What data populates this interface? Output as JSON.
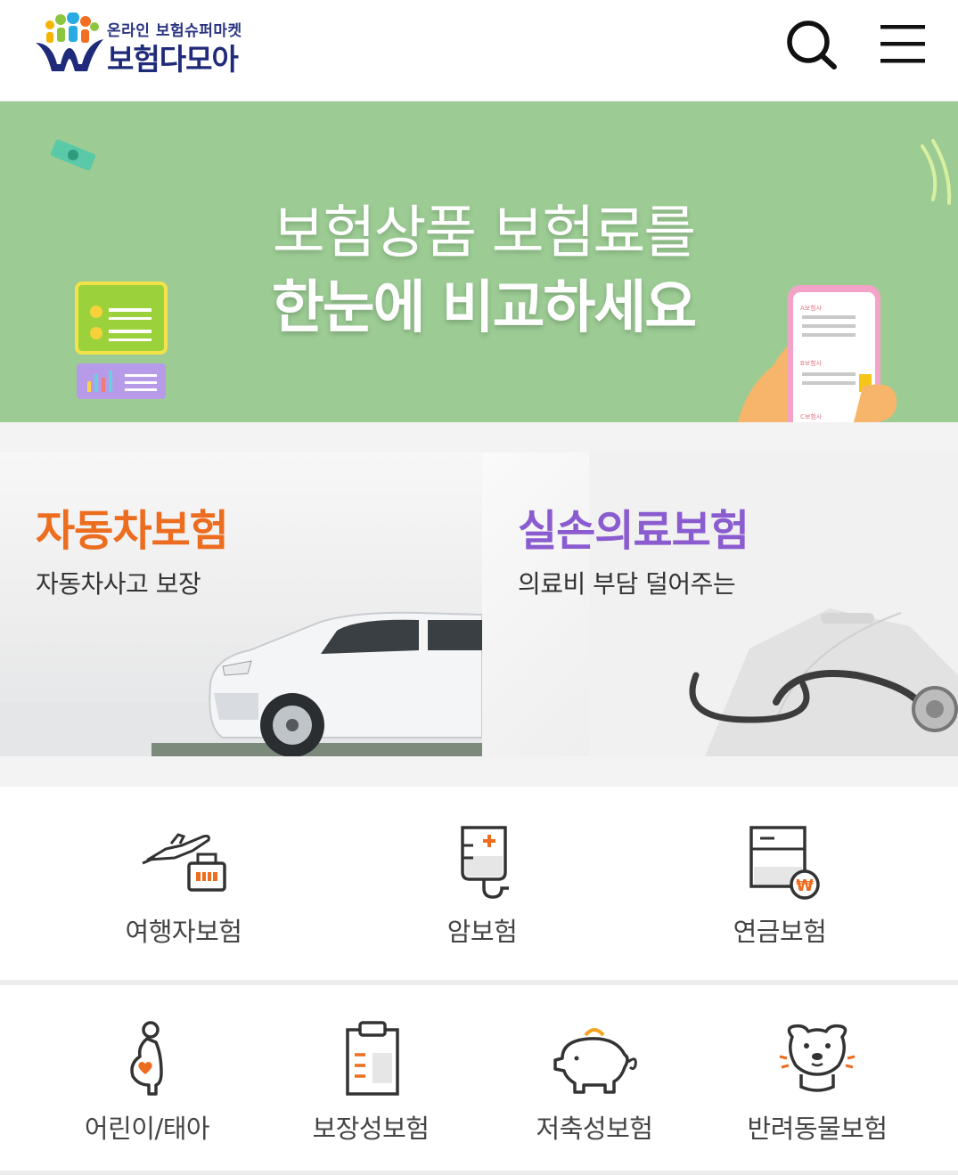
{
  "header": {
    "logo_tagline": "온라인 보험슈퍼마켓",
    "logo_name": "보험다모아",
    "search_icon": "search-icon",
    "menu_icon": "hamburger-menu-icon"
  },
  "banner": {
    "line1": "보험상품 보험료를",
    "line2": "한눈에 비교하세요",
    "phone_labels": [
      "A보험사",
      "B보험사",
      "C보험사"
    ]
  },
  "cards": [
    {
      "title": "자동차보험",
      "subtitle": "자동차사고 보장",
      "title_color": "#ec6d1f",
      "image": "car-image"
    },
    {
      "title": "실손의료보험",
      "subtitle": "의료비 부담 덜어주는",
      "title_color": "#8a5ccf",
      "image": "stethoscope-image"
    }
  ],
  "categories_row1": [
    {
      "label": "여행자보험",
      "icon": "airplane-luggage-icon"
    },
    {
      "label": "암보험",
      "icon": "iv-bag-icon"
    },
    {
      "label": "연금보험",
      "icon": "pension-won-icon"
    }
  ],
  "categories_row2": [
    {
      "label": "어린이/태아",
      "icon": "pregnant-woman-icon"
    },
    {
      "label": "보장성보험",
      "icon": "clipboard-icon"
    },
    {
      "label": "저축성보험",
      "icon": "piggy-bank-icon"
    },
    {
      "label": "반려동물보험",
      "icon": "dog-icon"
    }
  ],
  "colors": {
    "accent": "#ec6d1f",
    "brand_navy": "#1f2b7a",
    "banner_green": "#9ccc94",
    "medical_purple": "#8a5ccf"
  }
}
